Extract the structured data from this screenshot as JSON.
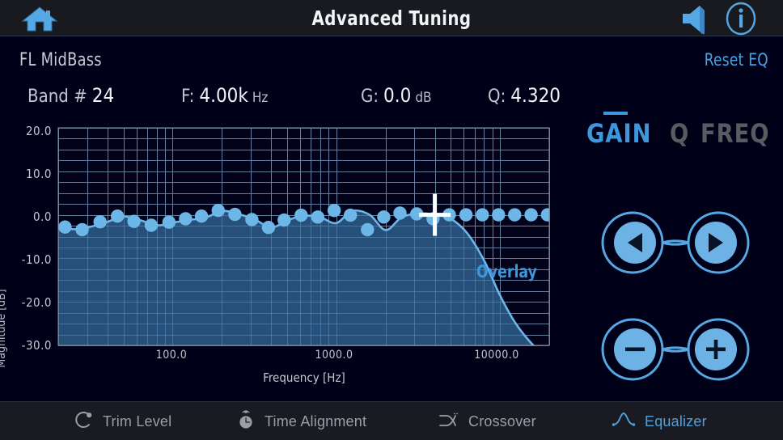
{
  "header": {
    "title": "Advanced Tuning",
    "home_icon": "home-icon",
    "speaker_icon": "speaker-mute-icon",
    "info_icon": "info-icon"
  },
  "subheader": {
    "channel": "FL MidBass",
    "reset_label": "Reset EQ"
  },
  "params": {
    "band": {
      "key": "Band #",
      "value": "24",
      "unit": ""
    },
    "freq": {
      "key": "F:",
      "value": "4.00k",
      "unit": "Hz"
    },
    "gain": {
      "key": "G:",
      "value": "0.0",
      "unit": "dB"
    },
    "q": {
      "key": "Q:",
      "value": "4.320",
      "unit": ""
    }
  },
  "modes": {
    "items": [
      {
        "label": "GAIN",
        "state": "active"
      },
      {
        "label": "Q",
        "state": "idle"
      },
      {
        "label": "FREQ",
        "state": "idle"
      }
    ]
  },
  "pads": {
    "nav": {
      "left_icon": "arrow-left-icon",
      "right_icon": "arrow-right-icon"
    },
    "adjust": {
      "minus_icon": "minus-icon",
      "plus_icon": "plus-icon"
    }
  },
  "navbar": {
    "items": [
      {
        "label": "Trim Level",
        "icon": "knob-icon",
        "state": "idle"
      },
      {
        "label": "Time Alignment",
        "icon": "stopwatch-icon",
        "state": "idle"
      },
      {
        "label": "Crossover",
        "icon": "crossover-icon",
        "state": "idle"
      },
      {
        "label": "Equalizer",
        "icon": "eq-peak-icon",
        "state": "active"
      }
    ]
  },
  "colors": {
    "accent": "#4aa3e0",
    "curve": "#6cb7e8",
    "fill": "#27527d",
    "inactive": "#595b61",
    "background": "#000018",
    "panel": "#191a22",
    "cursor": "#ffffff"
  },
  "chart_data": {
    "type": "line",
    "title": "",
    "annotation": "Overlay",
    "xlabel": "Frequency [Hz]",
    "ylabel": "Magnitude [dB]",
    "xscale": "log",
    "xlim": [
      20,
      20000
    ],
    "ylim": [
      -30.0,
      20.0
    ],
    "grid": true,
    "legend": "none",
    "xticks": [
      "100.0",
      "1000.0",
      "10000.0"
    ],
    "xtick_values": [
      100,
      1000,
      10000
    ],
    "yticks": [
      "20.0",
      "10.0",
      "0.0",
      "-10.0",
      "-20.0",
      "-30.0"
    ],
    "ytick_values": [
      20.0,
      10.0,
      0.0,
      -10.0,
      -20.0,
      -30.0
    ],
    "cursor": {
      "x_hz": 4000,
      "y_db": 0.0
    },
    "series": [
      {
        "name": "Response",
        "kind": "area-line",
        "x": [
          20,
          25,
          31,
          40,
          50,
          63,
          80,
          100,
          125,
          160,
          200,
          250,
          315,
          400,
          500,
          630,
          800,
          1000,
          1250,
          1600,
          2000,
          2500,
          3150,
          4000,
          5000,
          6300,
          8000,
          10000,
          12500,
          16000,
          20000
        ],
        "y": [
          -2.6,
          -3.3,
          -2.8,
          -1.6,
          -0.4,
          -1.2,
          -2.4,
          -1.8,
          -1.2,
          -0.6,
          0.9,
          0.2,
          -1.0,
          -2.9,
          -1.3,
          -0.2,
          -0.6,
          -1.9,
          0.9,
          0.0,
          -3.5,
          -0.6,
          0.3,
          0.1,
          -0.9,
          -4.2,
          -10.5,
          -18.5,
          -25.0,
          -30.0,
          -33.0
        ]
      },
      {
        "name": "Band markers",
        "kind": "dots",
        "x": [
          22,
          28,
          36,
          46,
          58,
          74,
          95,
          120,
          150,
          190,
          240,
          305,
          385,
          480,
          610,
          770,
          970,
          1220,
          1550,
          1950,
          2450,
          3100,
          3900,
          4900,
          6200,
          7800,
          9800,
          12300,
          15500,
          19500
        ],
        "y": [
          -2.8,
          -3.4,
          -1.6,
          -0.3,
          -1.5,
          -2.4,
          -1.7,
          -0.9,
          -0.3,
          1.0,
          0.1,
          -1.1,
          -2.9,
          -1.2,
          -0.1,
          -0.5,
          1.0,
          -0.1,
          -3.4,
          -0.5,
          0.4,
          0.2,
          -0.9,
          0.0,
          0.0,
          0.0,
          0.0,
          0.0,
          0.0,
          0.0
        ]
      }
    ]
  }
}
